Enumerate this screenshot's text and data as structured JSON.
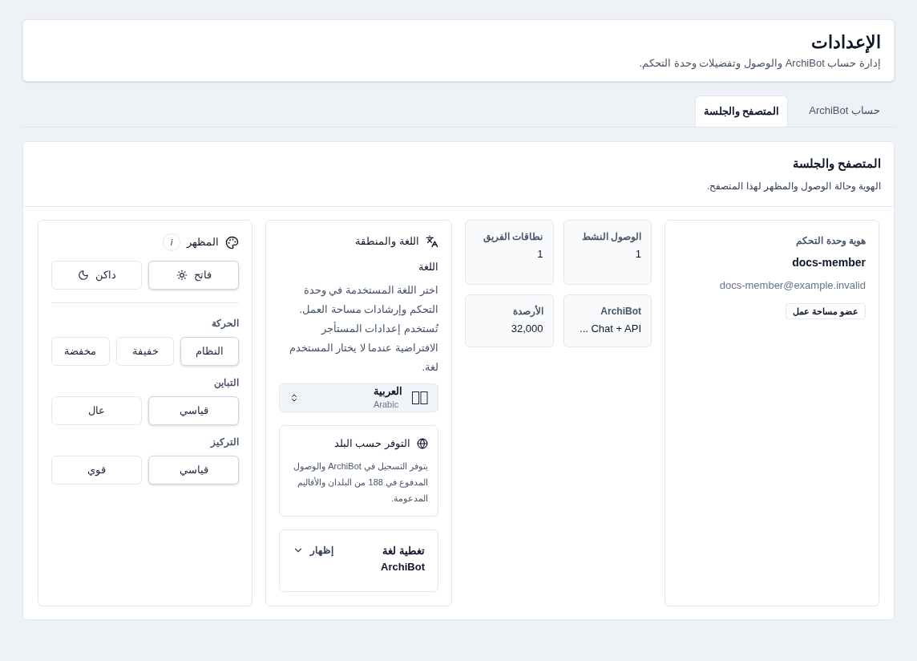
{
  "header": {
    "title": "الإعدادات",
    "subtitle": "إدارة حساب ArchiBot والوصول وتفضيلات وحدة التحكم."
  },
  "tabs": [
    {
      "label": "حساب ArchiBot",
      "selected": false
    },
    {
      "label": "المتصفح والجلسة",
      "selected": true
    }
  ],
  "section": {
    "title": "المتصفح والجلسة",
    "subtitle": "الهوية وحالة الوصول والمظهر لهذا المتصفح."
  },
  "identity": {
    "heading": "هوية وحدة التحكم",
    "name": "docs-member",
    "email": "docs-member@example.invalid",
    "badge": "عضو مساحة عمل"
  },
  "stats": [
    {
      "label": "الوصول النشط",
      "value": "1"
    },
    {
      "label": "نطاقات الفريق",
      "value": "1"
    },
    {
      "label": "ArchiBot",
      "value": "Chat + API ..."
    },
    {
      "label": "الأرصدة",
      "value": "32,000"
    }
  ],
  "language": {
    "title": "اللغة والمنطقة",
    "field_label": "اللغة",
    "description": "اختر اللغة المستخدمة في وحدة التحكم وإرشادات مساحة العمل. تُستخدم إعدادات المستأجر الافتراضية عندما لا يختار المستخدم لغة.",
    "select": {
      "value": "العربية",
      "sub": "Arabic"
    },
    "availability": {
      "title": "التوفر حسب البلد",
      "text": "يتوفر التسجيل في ArchiBot والوصول المدفوع في 188 من البلدان والأقاليم المدعومة."
    },
    "coverage": {
      "title": "تغطية لغة ArchiBot",
      "toggle": "إظهار",
      "expanded": false
    }
  },
  "appearance": {
    "title": "المظهر",
    "info": "i",
    "themes": [
      {
        "label": "فاتح",
        "kind": "sun",
        "selected": true
      },
      {
        "label": "داكن",
        "kind": "moon",
        "selected": false
      }
    ],
    "groups": [
      {
        "label": "الحركة",
        "options": [
          {
            "label": "النظام",
            "selected": true
          },
          {
            "label": "خفيفة",
            "selected": false
          },
          {
            "label": "مخفضة",
            "selected": false
          }
        ]
      },
      {
        "label": "التباين",
        "options": [
          {
            "label": "قياسي",
            "selected": true
          },
          {
            "label": "عال",
            "selected": false
          }
        ]
      },
      {
        "label": "التركيز",
        "options": [
          {
            "label": "قياسي",
            "selected": true
          },
          {
            "label": "قوي",
            "selected": false
          }
        ]
      }
    ]
  }
}
